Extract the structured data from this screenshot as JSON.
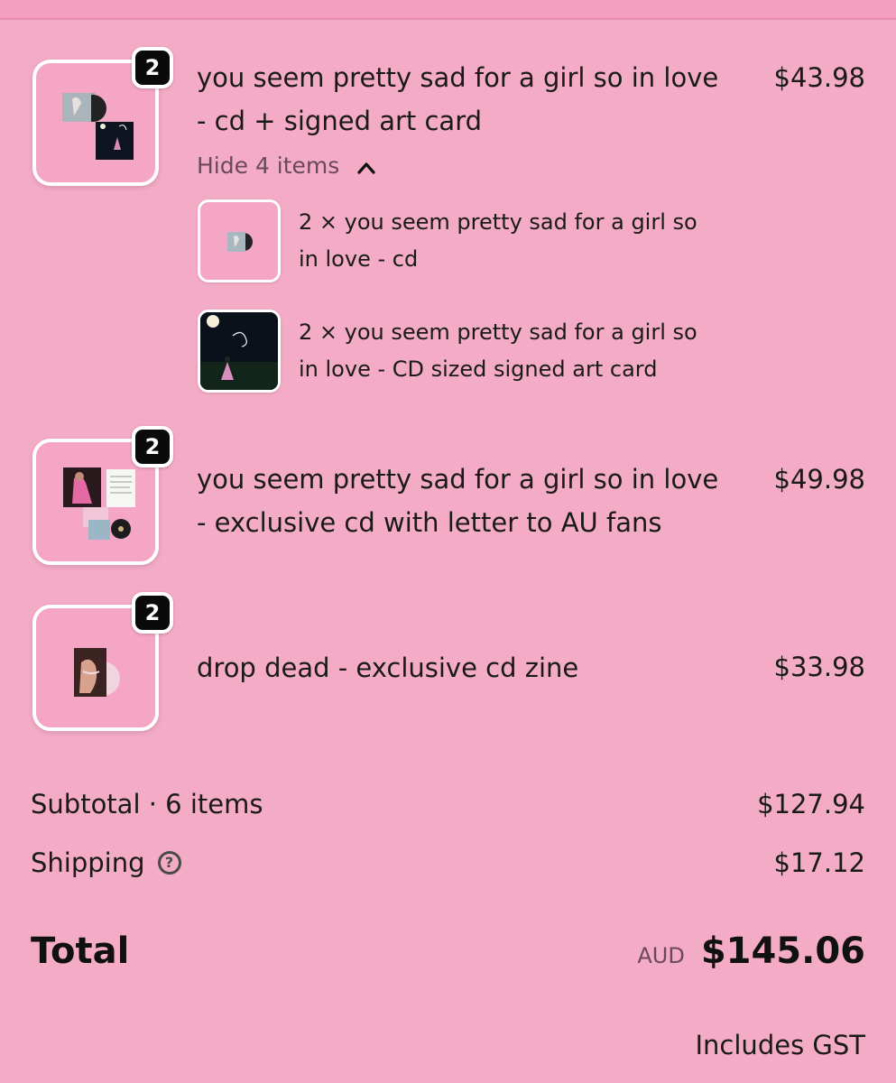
{
  "colors": {
    "background": "#f4abc6",
    "thumb_background": "#f4a6c4",
    "badge": "#0a0a0a",
    "muted_text": "#6b4a58"
  },
  "line_items": [
    {
      "quantity": "2",
      "title_line1": "you seem pretty sad for a girl so in love",
      "title_line2": "- cd + signed art card",
      "price": "$43.98",
      "toggle_label": "Hide 4 items",
      "toggle_icon": "chevron-up-icon",
      "components": [
        {
          "title_line1": "2 × you seem pretty sad for a girl so",
          "title_line2": "in love - cd"
        },
        {
          "title_line1": "2 × you seem pretty sad for a girl so",
          "title_line2": "in love - CD sized signed art card"
        }
      ]
    },
    {
      "quantity": "2",
      "title_line1": "you seem pretty sad for a girl so in love",
      "title_line2": "- exclusive cd with letter to AU fans",
      "price": "$49.98"
    },
    {
      "quantity": "2",
      "title_line1": "drop dead - exclusive cd zine",
      "price": "$33.98"
    }
  ],
  "summary": {
    "subtotal_label": "Subtotal · 6 items",
    "subtotal_value": "$127.94",
    "shipping_label": "Shipping",
    "shipping_help_icon": "question-circle-icon",
    "shipping_value": "$17.12",
    "total_label": "Total",
    "total_currency": "AUD",
    "total_value": "$145.06",
    "tax_note": "Includes GST"
  }
}
